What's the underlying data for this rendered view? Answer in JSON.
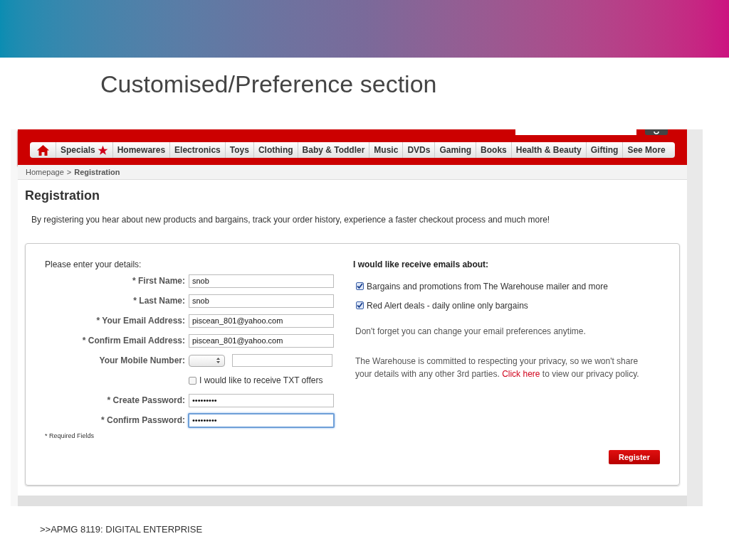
{
  "slide": {
    "title": "Customised/Preference section",
    "footer": ">>APMG 8119: DIGITAL ENTERPRISE"
  },
  "nav": {
    "items": [
      {
        "label": "Specials",
        "kind": "featured"
      },
      {
        "label": "Homewares",
        "kind": "plain"
      },
      {
        "label": "Electronics",
        "kind": "plain"
      },
      {
        "label": "Toys",
        "kind": "plain"
      },
      {
        "label": "Clothing",
        "kind": "plain"
      },
      {
        "label": "Baby & Toddler",
        "kind": "plain"
      },
      {
        "label": "Music",
        "kind": "plain"
      },
      {
        "label": "DVDs",
        "kind": "plain"
      },
      {
        "label": "Gaming",
        "kind": "plain"
      },
      {
        "label": "Books",
        "kind": "plain"
      },
      {
        "label": "Health & Beauty",
        "kind": "plain"
      },
      {
        "label": "Gifting",
        "kind": "plain"
      },
      {
        "label": "See More",
        "kind": "plain"
      }
    ]
  },
  "breadcrumb": [
    {
      "label": "Homepage",
      "selected": false
    },
    {
      "label": "Registration",
      "selected": true
    }
  ],
  "breadcrumb_separator": ">",
  "page": {
    "heading": "Registration",
    "intro": "By registering you hear about new products and bargains, track your order history, experience a faster checkout process and much more!"
  },
  "form": {
    "heading": "Please enter your details:",
    "fields": [
      {
        "kind": "text",
        "label": "* First Name:",
        "value": "snob",
        "focused": false
      },
      {
        "kind": "text",
        "label": "* Last Name:",
        "value": "snob",
        "focused": false
      },
      {
        "kind": "text",
        "label": "* Your Email Address:",
        "value": "piscean_801@yahoo.com",
        "focused": false
      },
      {
        "kind": "text",
        "label": "* Confirm Email Address:",
        "value": "piscean_801@yahoo.com",
        "focused": false
      },
      {
        "kind": "phone",
        "label": "Your Mobile Number:",
        "offer": {
          "label": "I would like to receive TXT offers",
          "checked": false
        }
      },
      {
        "kind": "text",
        "label": "* Create Password:",
        "value": "•••••••••",
        "focused": false
      },
      {
        "kind": "text",
        "label": "* Confirm Password:",
        "value": "•••••••••",
        "focused": true
      }
    ],
    "required_note": "* Required Fields"
  },
  "emails": {
    "heading": "I would like receive emails about:",
    "options": [
      {
        "label": "Bargains and promotions from The Warehouse mailer and more",
        "checked": true
      },
      {
        "label": "Red Alert deals - daily online only bargains",
        "checked": true
      }
    ],
    "reminder": "Don't forget you can change your email preferences anytime.",
    "privacy_before": "The Warehouse is committed to respecting your privacy, so we won't share your details with any other 3rd parties.",
    "privacy_link": "Click here",
    "privacy_after": "to view our privacy policy."
  },
  "register_button": "Register"
}
